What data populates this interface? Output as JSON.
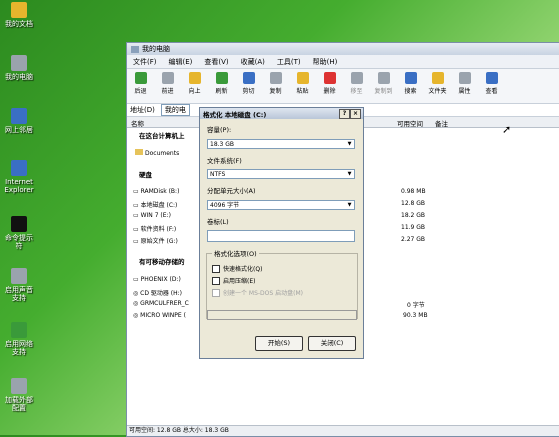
{
  "desktop": {
    "icons": [
      {
        "label": "我的文档",
        "icon": "folder-icon"
      },
      {
        "label": "我的电脑",
        "icon": "computer-icon"
      },
      {
        "label": "网上邻居",
        "icon": "network-icon"
      },
      {
        "label": "Internet Explorer",
        "icon": "ie-icon"
      },
      {
        "label": "命令提示符",
        "icon": "cmd-icon"
      },
      {
        "label": "启用声音支持",
        "icon": "sound-icon"
      },
      {
        "label": "启用网络支持",
        "icon": "network-support-icon"
      },
      {
        "label": "加载外部配置",
        "icon": "config-icon"
      }
    ]
  },
  "window": {
    "title": "我的电脑",
    "menu": [
      "文件(F)",
      "编辑(E)",
      "查看(V)",
      "收藏(A)",
      "工具(T)",
      "帮助(H)"
    ],
    "toolbar": [
      "后退",
      "前进",
      "向上",
      "刷新",
      "剪切",
      "复制",
      "粘贴",
      "删除",
      "移至",
      "复制到",
      "搜索",
      "文件夹",
      "属性",
      "查看"
    ],
    "address_label": "地址(D)",
    "address_value": "我的电",
    "columns": [
      "名称",
      "可用空间",
      "备注"
    ],
    "groups": [
      "在这台计算机上",
      "硬盘",
      "有可移动存储的"
    ],
    "documents": "Documents",
    "drives": [
      {
        "name": "RAMDisk (B:)",
        "free": "0.98 MB"
      },
      {
        "name": "本地磁盘 (C:)",
        "free": "12.8 GB"
      },
      {
        "name": "WIN 7 (E:)",
        "free": "18.2 GB"
      },
      {
        "name": "软件资料 (F:)",
        "free": "11.9 GB"
      },
      {
        "name": "原始文件 (G:)",
        "free": "2.27 GB"
      }
    ],
    "removable": [
      {
        "name": "PHOENIX (D:)",
        "free": ""
      },
      {
        "name": "CD 驱动器 (H:)",
        "free": ""
      },
      {
        "name": "GRMCULFRER_C",
        "free": "0 字节"
      },
      {
        "name": "MICRO WINPE (",
        "free": "90.3 MB"
      }
    ],
    "status": "可用空间: 12.8 GB 总大小: 18.3 GB"
  },
  "dialog": {
    "title": "格式化 本地磁盘 (C:)",
    "help": "?",
    "close": "×",
    "capacity_label": "容量(P):",
    "capacity_value": "18.3 GB",
    "fs_label": "文件系统(F)",
    "fs_value": "NTFS",
    "alloc_label": "分配单元大小(A)",
    "alloc_value": "4096 字节",
    "volume_label": "卷标(L)",
    "volume_value": "",
    "options_label": "格式化选项(O)",
    "quick_format": "快速格式化(Q)",
    "compression": "启用压缩(E)",
    "msdos": "创建一个 MS-DOS 启动盘(M)",
    "start_button": "开始(S)",
    "close_button": "关闭(C)"
  }
}
